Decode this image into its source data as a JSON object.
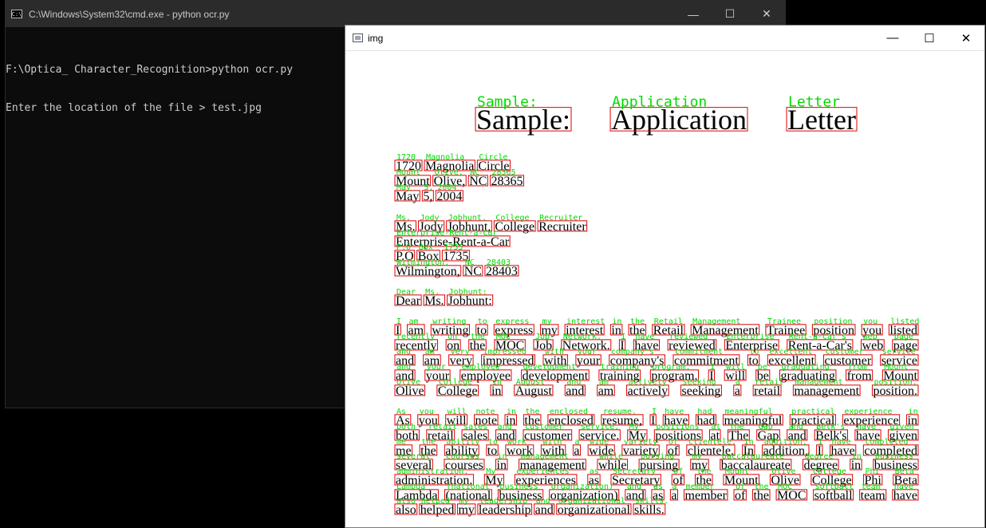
{
  "cmd": {
    "title": "C:\\Windows\\System32\\cmd.exe - python  ocr.py",
    "icon": "cmd-icon",
    "lines": [
      "F:\\Optica_ Character_Recognition>python ocr.py",
      "Enter the location of the file > test.jpg"
    ]
  },
  "img_window": {
    "title": "img",
    "icon": "image-icon"
  },
  "controls": {
    "minimize": "—",
    "maximize": "☐",
    "close": "✕"
  },
  "colors": {
    "box": "#e00000",
    "label": "#00dc00"
  },
  "document": {
    "heading": [
      "Sample:",
      "Application",
      "Letter"
    ],
    "lines": [
      [
        "1720",
        "Magnolia",
        "Circle"
      ],
      [
        "Mount",
        "Olive,",
        "NC",
        "28365"
      ],
      [
        "May",
        "5,",
        "2004"
      ],
      [
        "Ms.",
        "Jody",
        "Jobhunt,",
        "College",
        "Recruiter"
      ],
      [
        "Enterprise-Rent-a-Car"
      ],
      [
        "P.O",
        "Box",
        "1735"
      ],
      [
        "Wilmington,",
        "NC",
        "28403"
      ],
      [
        "Dear",
        "Ms.",
        "Jobhunt:"
      ],
      [
        "I",
        "am",
        "writing",
        "to",
        "express",
        "my",
        "interest",
        "in",
        "the",
        "Retail",
        "Management",
        "Trainee",
        "position",
        "you",
        "listed"
      ],
      [
        "recently",
        "on",
        "the",
        "MOC",
        "Job",
        "Network.",
        "I",
        "have",
        "reviewed",
        "Enterprise",
        "Rent-a-Car's",
        "web",
        "page"
      ],
      [
        "and",
        "am",
        "very",
        "impressed",
        "with",
        "your",
        "company's",
        "commitment",
        "to",
        "excellent",
        "customer",
        "service"
      ],
      [
        "and",
        "your",
        "employee",
        "development",
        "training",
        "program.",
        "I",
        "will",
        "be",
        "graduating",
        "from",
        "Mount"
      ],
      [
        "Olive",
        "College",
        "in",
        "August",
        "and",
        "am",
        "actively",
        "seeking",
        "a",
        "retail",
        "management",
        "position."
      ],
      [
        "As",
        "you",
        "will",
        "note",
        "in",
        "the",
        "enclosed",
        "resume,",
        "I",
        "have",
        "had",
        "meaningful",
        "practical",
        "experience",
        "in"
      ],
      [
        "both",
        "retail",
        "sales",
        "and",
        "customer",
        "service.",
        "My",
        "positions",
        "at",
        "The",
        "Gap",
        "and",
        "Belk's",
        "have",
        "given"
      ],
      [
        "me",
        "the",
        "ability",
        "to",
        "work",
        "with",
        "a",
        "wide",
        "variety",
        "of",
        "clientele.",
        "In",
        "addition,",
        "I",
        "have",
        "completed"
      ],
      [
        "several",
        "courses",
        "in",
        "management",
        "while",
        "pursing",
        "my",
        "baccalaureate",
        "degree",
        "in",
        "business"
      ],
      [
        "administration.",
        "My",
        "experiences",
        "as",
        "Secretary",
        "of",
        "the",
        "Mount",
        "Olive",
        "College",
        "Phi",
        "Beta"
      ],
      [
        "Lambda",
        "(national",
        "business",
        "organization)",
        "and",
        "as",
        "a",
        "member",
        "of",
        "the",
        "MOC",
        "softball",
        "team",
        "have"
      ],
      [
        "also",
        "helped",
        "my",
        "leadership",
        "and",
        "organizational",
        "skills."
      ]
    ]
  }
}
